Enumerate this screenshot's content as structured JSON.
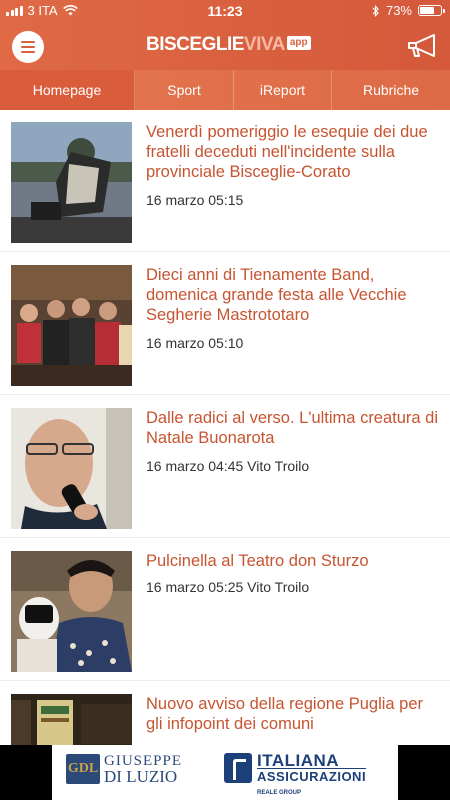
{
  "status_bar": {
    "carrier": "3 ITA",
    "time": "11:23",
    "battery": "73%",
    "battery_level": 0.73
  },
  "header": {
    "logo_part1": "BISCEGLIE",
    "logo_part2": "VIVA",
    "logo_badge": "app",
    "menu_icon": "hamburger-menu-icon",
    "announce_icon": "megaphone-icon"
  },
  "tabs": [
    {
      "label": "Homepage",
      "active": true
    },
    {
      "label": "Sport",
      "active": false
    },
    {
      "label": "iReport",
      "active": false
    },
    {
      "label": "Rubriche",
      "active": false
    }
  ],
  "articles": [
    {
      "title": "Venerdì pomeriggio le esequie dei due fratelli deceduti nell'incidente sulla provinciale Bisceglie-Corato",
      "meta": "16 marzo 05:15"
    },
    {
      "title": "Dieci anni di Tienamente Band, domenica grande festa alle Vecchie Segherie Mastrototaro",
      "meta": "16 marzo 05:10"
    },
    {
      "title": "Dalle radici al verso. L'ultima creatura di Natale Buonarota",
      "meta": "16 marzo 04:45 Vito Troilo"
    },
    {
      "title": "Pulcinella al Teatro don Sturzo",
      "meta": "16 marzo 05:25 Vito Troilo"
    },
    {
      "title": "Nuovo avviso della regione Puglia per gli infopoint dei comuni",
      "meta": ""
    }
  ],
  "ad": {
    "left_mark": "GDL",
    "left_line1": "GIUSEPPE",
    "left_line2": "DI LUZIO",
    "right_line1": "ITALIANA",
    "right_line2": "ASSICURAZIONI",
    "right_line3": "REALE GROUP"
  },
  "colors": {
    "brand": "#d9603f",
    "title_text": "#c75431"
  }
}
